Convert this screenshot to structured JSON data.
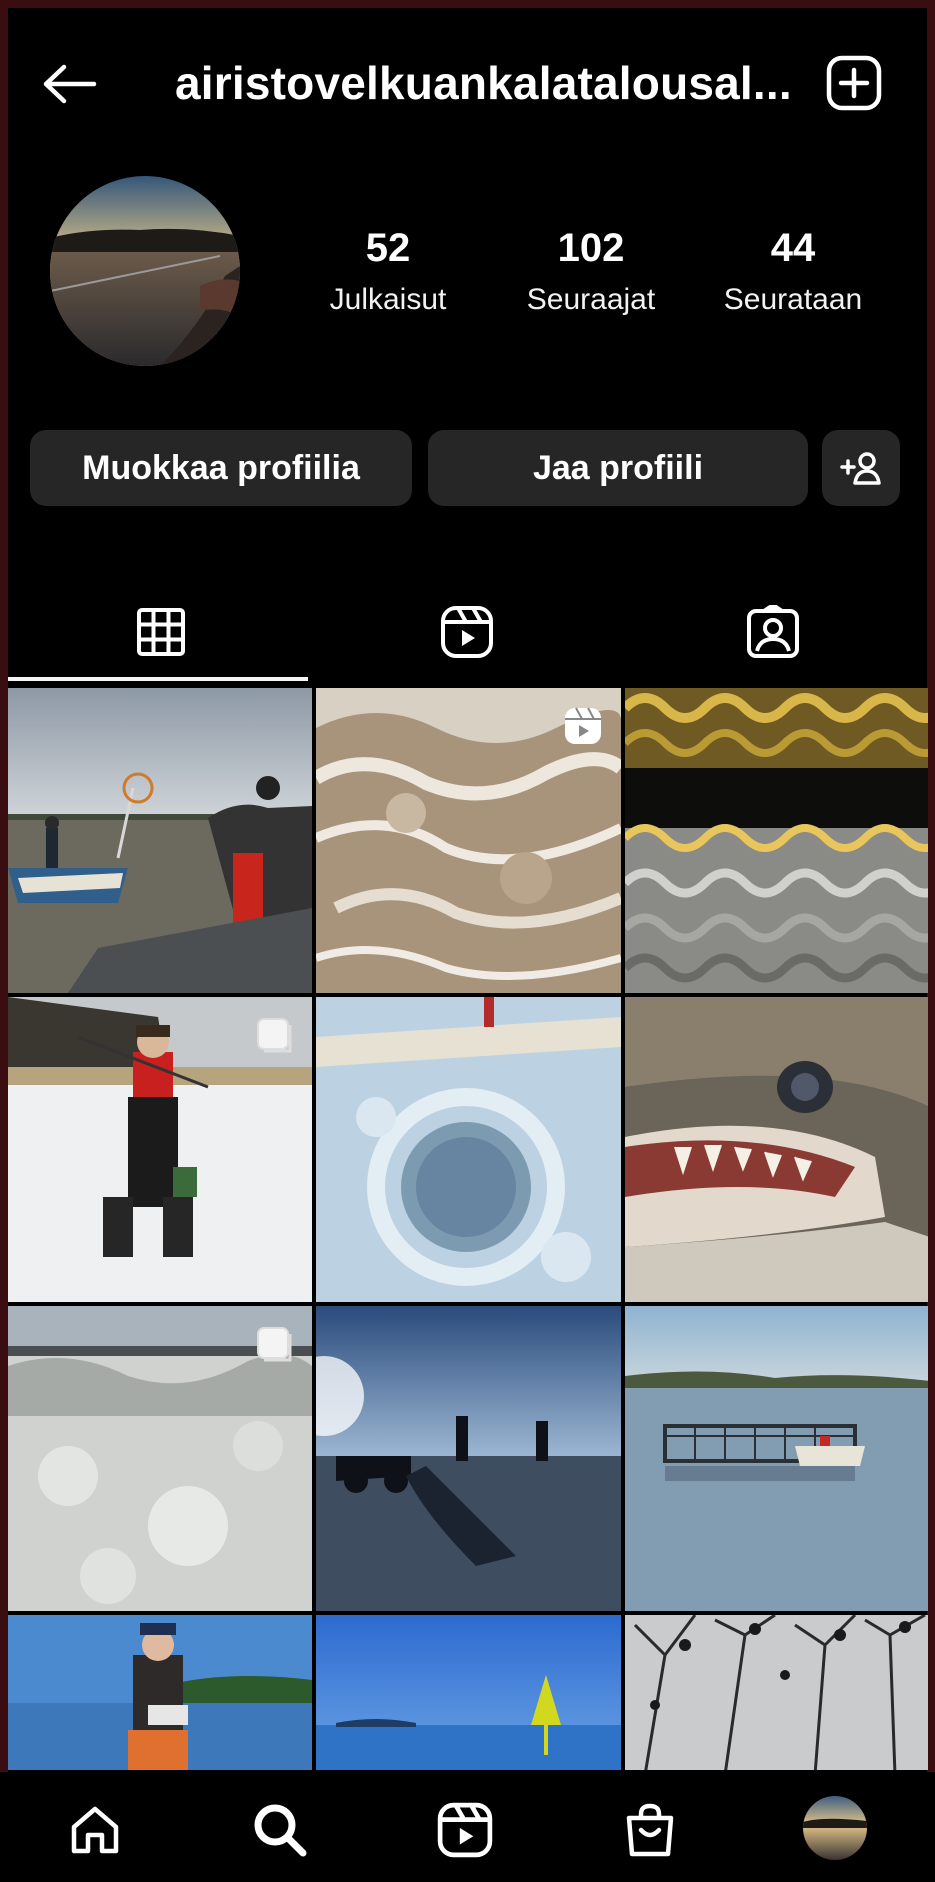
{
  "header": {
    "username": "airistovelkuankalatalousal...",
    "back_icon": "arrow-left-icon",
    "create_icon": "plus-square-icon"
  },
  "profile": {
    "stats": [
      {
        "value": "52",
        "label": "Julkaisut"
      },
      {
        "value": "102",
        "label": "Seuraajat"
      },
      {
        "value": "44",
        "label": "Seurataan"
      }
    ]
  },
  "actions": {
    "edit_label": "Muokkaa profiilia",
    "share_label": "Jaa profiili",
    "discover_icon": "add-person-icon"
  },
  "tabs": [
    {
      "icon": "grid-icon",
      "active": true
    },
    {
      "icon": "reels-icon",
      "active": false
    },
    {
      "icon": "tagged-icon",
      "active": false
    }
  ],
  "posts": [
    {
      "badge": null
    },
    {
      "badge": "reel"
    },
    {
      "badge": null
    },
    {
      "badge": "carousel"
    },
    {
      "badge": null
    },
    {
      "badge": null
    },
    {
      "badge": "carousel"
    },
    {
      "badge": null
    },
    {
      "badge": null
    },
    {
      "badge": null
    },
    {
      "badge": null
    },
    {
      "badge": null
    }
  ],
  "nav": [
    {
      "icon": "home-icon"
    },
    {
      "icon": "search-icon"
    },
    {
      "icon": "reels-icon"
    },
    {
      "icon": "shop-icon"
    },
    {
      "icon": "profile-avatar"
    }
  ],
  "colors": {
    "background": "#000000",
    "button": "#262626",
    "text": "#ffffff"
  }
}
